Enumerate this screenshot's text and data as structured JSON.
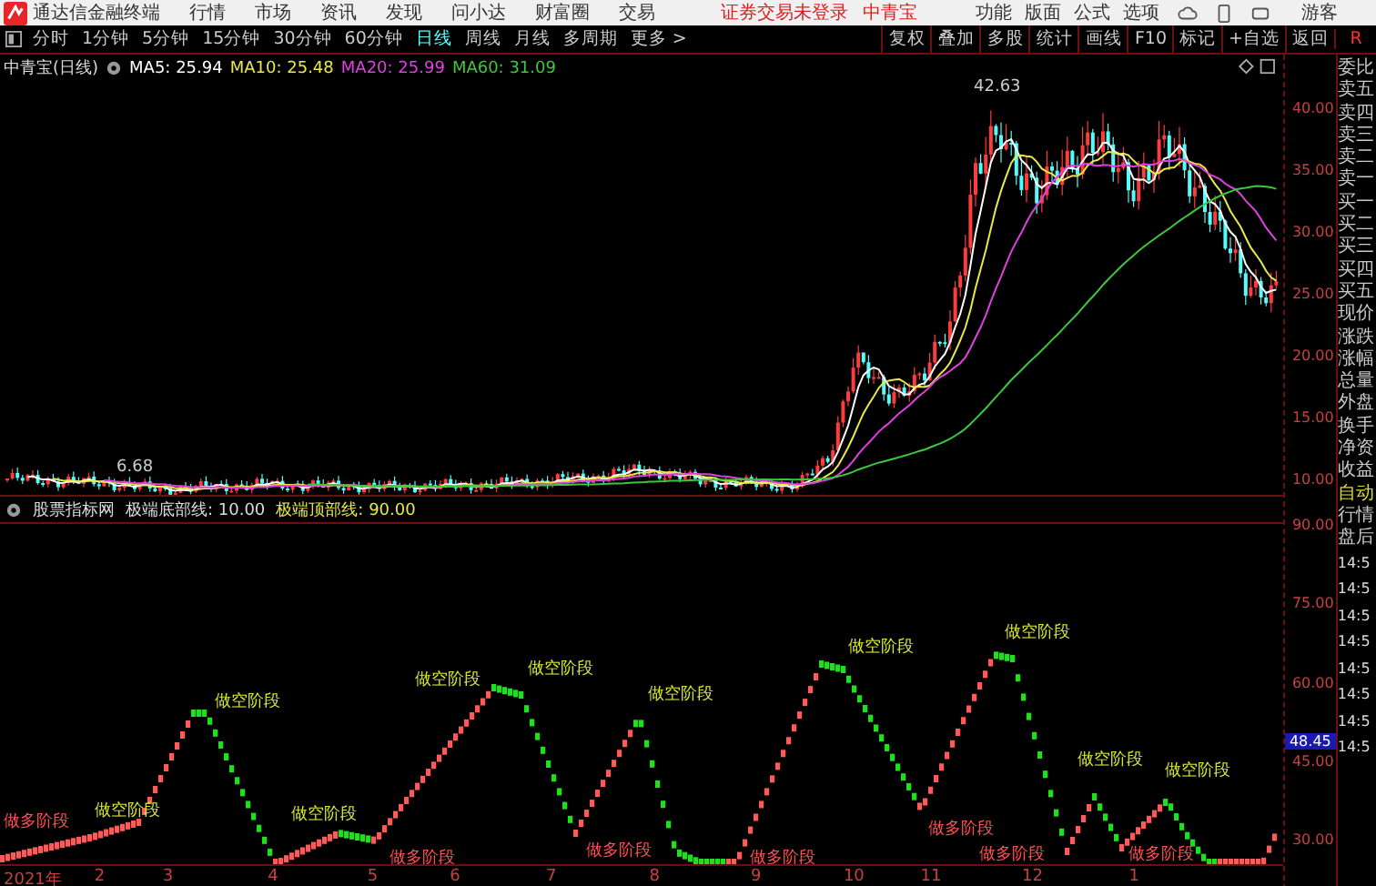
{
  "app": {
    "name": "通达信金融终端",
    "menus": [
      "行情",
      "市场",
      "资讯",
      "发现",
      "问小达",
      "财富圈",
      "交易"
    ],
    "login_status": "证券交易未登录",
    "stock": "中青宝",
    "tools": [
      "功能",
      "版面",
      "公式",
      "选项"
    ],
    "user": "游客"
  },
  "periods": [
    {
      "label": "分时",
      "selected": false
    },
    {
      "label": "1分钟",
      "selected": false
    },
    {
      "label": "5分钟",
      "selected": false
    },
    {
      "label": "15分钟",
      "selected": false
    },
    {
      "label": "30分钟",
      "selected": false
    },
    {
      "label": "60分钟",
      "selected": false
    },
    {
      "label": "日线",
      "selected": true
    },
    {
      "label": "周线",
      "selected": false
    },
    {
      "label": "月线",
      "selected": false
    },
    {
      "label": "多周期",
      "selected": false
    },
    {
      "label": "更多 >",
      "selected": false
    }
  ],
  "actions": [
    "复权",
    "叠加",
    "多股",
    "统计",
    "画线",
    "F10",
    "标记",
    "+自选",
    "返回"
  ],
  "chart": {
    "title": "中青宝(日线)",
    "ma": [
      {
        "label": "MA5: 25.94",
        "color": "#ffffff"
      },
      {
        "label": "MA10: 25.48",
        "color": "#e8e84a"
      },
      {
        "label": "MA20: 25.99",
        "color": "#e040e0"
      },
      {
        "label": "MA60: 31.09",
        "color": "#3cc83c"
      }
    ],
    "high": "42.63",
    "low": "6.68",
    "price_ticks": [
      "40.00",
      "35.00",
      "30.00",
      "25.00",
      "20.00",
      "15.00",
      "10.00"
    ]
  },
  "indicator": {
    "name": "股票指标网",
    "bottom_line": "极端底部线: 10.00",
    "top_line": "极端顶部线: 90.00",
    "ticks": [
      "90.00",
      "75.00",
      "60.00",
      "45.00",
      "30.00"
    ],
    "current": "48.45",
    "signals": [
      {
        "kind": "long",
        "label": "做多阶段"
      },
      {
        "kind": "short",
        "label": "做空阶段"
      },
      {
        "kind": "short",
        "label": "做空阶段"
      },
      {
        "kind": "short",
        "label": "做空阶段"
      },
      {
        "kind": "long",
        "label": "做多阶段"
      },
      {
        "kind": "short",
        "label": "做空阶段"
      },
      {
        "kind": "short",
        "label": "做空阶段"
      },
      {
        "kind": "long",
        "label": "做多阶段"
      },
      {
        "kind": "short",
        "label": "做空阶段"
      },
      {
        "kind": "long",
        "label": "做多阶段"
      },
      {
        "kind": "short",
        "label": "做空阶段"
      },
      {
        "kind": "long",
        "label": "做多阶段"
      },
      {
        "kind": "short",
        "label": "做空阶段"
      },
      {
        "kind": "long",
        "label": "做多阶段"
      },
      {
        "kind": "short",
        "label": "做空阶段"
      },
      {
        "kind": "long",
        "label": "做多阶段"
      },
      {
        "kind": "short",
        "label": "做空阶段"
      }
    ]
  },
  "x_labels": [
    "2021年",
    "2",
    "3",
    "4",
    "5",
    "6",
    "7",
    "8",
    "9",
    "10",
    "11",
    "12",
    "1"
  ],
  "side_panel": {
    "corner": "R",
    "items": [
      {
        "label": "委比",
        "kind": "field"
      },
      {
        "label": "卖五",
        "kind": "field"
      },
      {
        "label": "卖四",
        "kind": "field"
      },
      {
        "label": "卖三",
        "kind": "field"
      },
      {
        "label": "卖二",
        "kind": "field"
      },
      {
        "label": "卖一",
        "kind": "field"
      },
      {
        "label": "买一",
        "kind": "field"
      },
      {
        "label": "买二",
        "kind": "field"
      },
      {
        "label": "买三",
        "kind": "field"
      },
      {
        "label": "买四",
        "kind": "field"
      },
      {
        "label": "买五",
        "kind": "field"
      },
      {
        "label": "现价",
        "kind": "field"
      },
      {
        "label": "涨跌",
        "kind": "field"
      },
      {
        "label": "涨幅",
        "kind": "field"
      },
      {
        "label": "总量",
        "kind": "field"
      },
      {
        "label": "外盘",
        "kind": "field"
      },
      {
        "label": "换手",
        "kind": "field"
      },
      {
        "label": "净资",
        "kind": "field"
      },
      {
        "label": "收益",
        "kind": "field"
      },
      {
        "label": "自动",
        "kind": "status"
      },
      {
        "label": "行情",
        "kind": "field"
      },
      {
        "label": "盘后",
        "kind": "field"
      }
    ],
    "times": [
      "14:5",
      "14:5",
      "14:5",
      "14:5",
      "14:5",
      "14:5",
      "14:5",
      "14:5"
    ]
  }
}
